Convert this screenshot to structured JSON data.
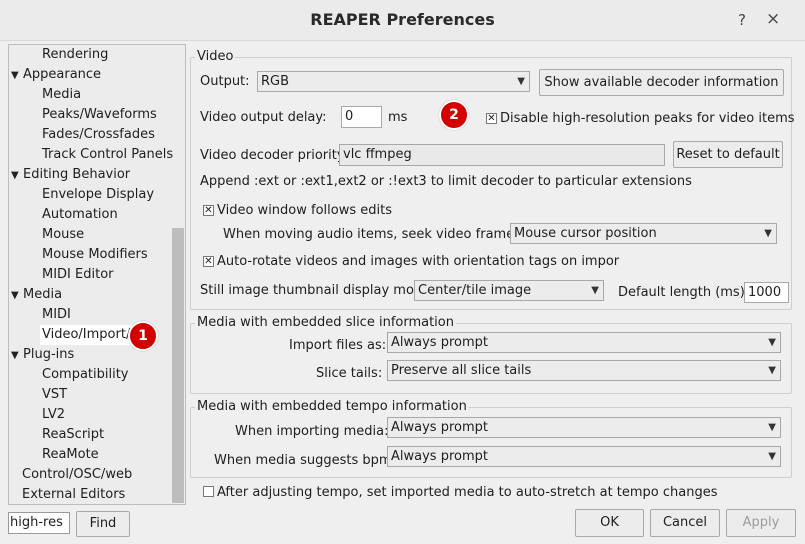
{
  "window": {
    "title": "REAPER Preferences",
    "help_glyph": "?",
    "close_glyph": "×"
  },
  "tree": {
    "items": [
      {
        "label": "Rendering"
      },
      {
        "label": "Appearance"
      },
      {
        "label": "Media"
      },
      {
        "label": "Peaks/Waveforms"
      },
      {
        "label": "Fades/Crossfades"
      },
      {
        "label": "Track Control Panels"
      },
      {
        "label": "Editing Behavior"
      },
      {
        "label": "Envelope Display"
      },
      {
        "label": "Automation"
      },
      {
        "label": "Mouse"
      },
      {
        "label": "Mouse Modifiers"
      },
      {
        "label": "MIDI Editor"
      },
      {
        "label": "Media"
      },
      {
        "label": "MIDI"
      },
      {
        "label": "Video/Import/"
      },
      {
        "label": "Plug-ins"
      },
      {
        "label": "Compatibility"
      },
      {
        "label": "VST"
      },
      {
        "label": "LV2"
      },
      {
        "label": "ReaScript"
      },
      {
        "label": "ReaMote"
      },
      {
        "label": "Control/OSC/web"
      },
      {
        "label": "External Editors"
      }
    ],
    "caret_glyph": "▼"
  },
  "search": {
    "value": "high-res",
    "find_label": "Find"
  },
  "video": {
    "group_title": "Video",
    "output_label": "Output:",
    "output_value": "RGB",
    "decoder_info_button": "Show available decoder information",
    "delay_label": "Video output delay:",
    "delay_value": "0",
    "delay_unit": "ms",
    "disable_peaks_label": "Disable high-resolution peaks for video items",
    "disable_peaks_checked": true,
    "decoder_priority_label": "Video decoder priority",
    "decoder_priority_value": "vlc ffmpeg",
    "reset_button": "Reset to default",
    "append_hint": "Append :ext or :ext1,ext2 or :!ext3 to limit decoder to particular extensions",
    "follows_edits_label": "Video window follows edits",
    "follows_edits_checked": true,
    "seek_label": "When moving audio items, seek video frame to:",
    "seek_value": "Mouse cursor position",
    "autorotate_label": "Auto-rotate videos and images with orientation tags on impor",
    "autorotate_checked": true,
    "thumbnail_label": "Still image thumbnail display moc",
    "thumbnail_value": "Center/tile image",
    "default_length_label": "Default length (ms):",
    "default_length_value": "1000"
  },
  "slice": {
    "group_title": "Media with embedded slice information",
    "import_label": "Import files as:",
    "import_value": "Always prompt",
    "tails_label": "Slice tails:",
    "tails_value": "Preserve all slice tails"
  },
  "tempo": {
    "group_title": "Media with embedded tempo information",
    "importing_label": "When importing media:",
    "importing_value": "Always prompt",
    "suggests_label": "When media suggests bpm:",
    "suggests_value": "Always prompt",
    "autostretch_label": "After adjusting tempo, set imported media to auto-stretch at tempo changes",
    "autostretch_checked": false
  },
  "buttons": {
    "ok": "OK",
    "cancel": "Cancel",
    "apply": "Apply"
  },
  "annotations": {
    "badge1": "1",
    "badge2": "2"
  },
  "colors": {
    "badge": "#d40000",
    "selection": "#ffffff"
  }
}
